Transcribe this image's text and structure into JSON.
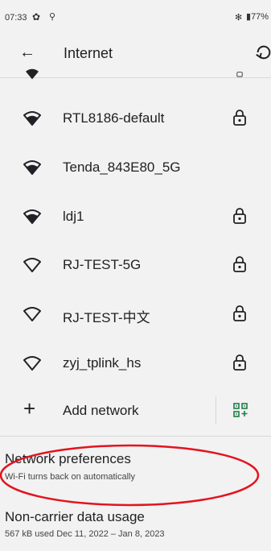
{
  "status_bar": {
    "time": "07:33",
    "battery": "77%"
  },
  "app_bar": {
    "title": "Internet"
  },
  "networks": [
    {
      "ssid": "RTL8186-default",
      "locked": true
    },
    {
      "ssid": "Tenda_843E80_5G",
      "locked": false
    },
    {
      "ssid": "ldj1",
      "locked": true
    },
    {
      "ssid": "RJ-TEST-5G",
      "locked": true
    },
    {
      "ssid": "RJ-TEST-中文",
      "locked": true
    },
    {
      "ssid": "zyj_tplink_hs",
      "locked": true
    }
  ],
  "add_network": {
    "label": "Add network"
  },
  "network_preferences": {
    "title": "Network preferences",
    "subtitle": "Wi-Fi turns back on automatically"
  },
  "non_carrier_usage": {
    "title": "Non-carrier data usage",
    "subtitle": "567 kB used Dec 11, 2022 – Jan 8, 2023"
  },
  "colors": {
    "background": "#f2f2f2",
    "annotation_circle": "#e3141f",
    "text": "#202124"
  }
}
